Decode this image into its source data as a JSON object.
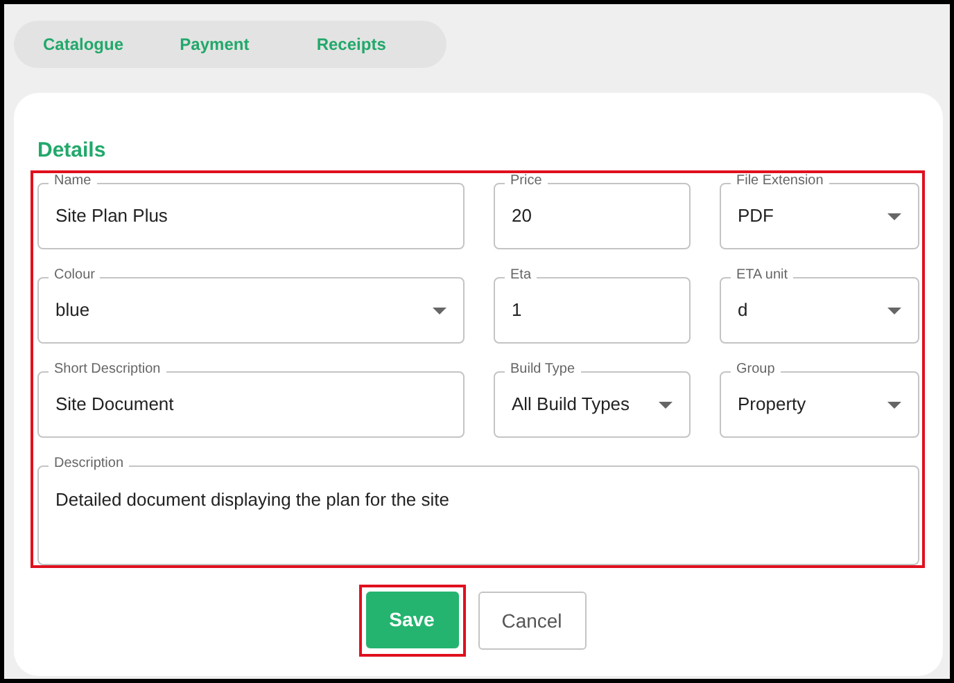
{
  "tabs": [
    {
      "label": "Catalogue",
      "selected": false
    },
    {
      "label": "Payment",
      "selected": false
    },
    {
      "label": "Receipts",
      "selected": false
    }
  ],
  "section_title": "Details",
  "form": {
    "highlighted": true,
    "fields": [
      {
        "kind": "text",
        "label": "Name",
        "value": "Site Plan Plus"
      },
      {
        "kind": "text",
        "label": "Price",
        "value": "20"
      },
      {
        "kind": "select",
        "label": "File Extension",
        "value": "PDF"
      },
      {
        "kind": "select",
        "label": "Colour",
        "value": "blue"
      },
      {
        "kind": "text",
        "label": "Eta",
        "value": "1"
      },
      {
        "kind": "select",
        "label": "ETA unit",
        "value": "d"
      },
      {
        "kind": "text",
        "label": "Short Description",
        "value": "Site Document"
      },
      {
        "kind": "select",
        "label": "Build Type",
        "value": "All Build Types"
      },
      {
        "kind": "select",
        "label": "Group",
        "value": "Property"
      },
      {
        "kind": "textarea",
        "label": "Description",
        "value": "Detailed document displaying the plan for the site"
      }
    ]
  },
  "buttons": [
    {
      "kind": "primary",
      "label": "Save",
      "highlighted": true
    },
    {
      "kind": "secondary",
      "label": "Cancel",
      "highlighted": false
    }
  ]
}
